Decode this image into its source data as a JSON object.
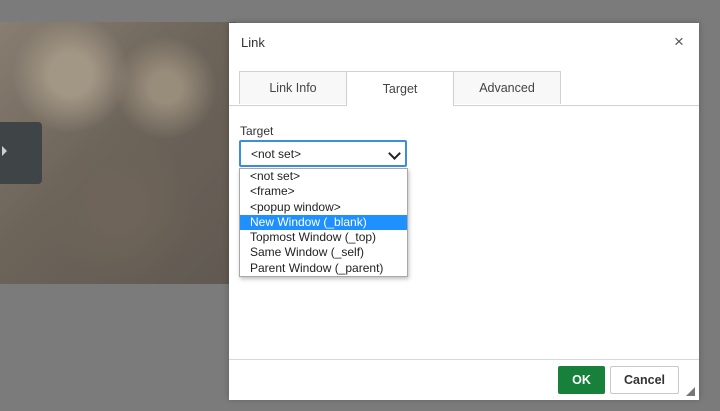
{
  "dialog": {
    "title": "Link",
    "close_label": "×",
    "tabs": [
      {
        "label": "Link Info",
        "active": false
      },
      {
        "label": "Target",
        "active": true
      },
      {
        "label": "Advanced",
        "active": false
      }
    ],
    "target": {
      "label": "Target",
      "selected_value": "<not set>",
      "options": [
        "<not set>",
        "<frame>",
        "<popup window>",
        "New Window (_blank)",
        "Topmost Window (_top)",
        "Same Window (_self)",
        "Parent Window (_parent)"
      ],
      "highlighted_option": "New Window (_blank)"
    },
    "footer": {
      "ok_label": "OK",
      "cancel_label": "Cancel"
    }
  },
  "colors": {
    "ok_button": "#17803a",
    "focus_border": "#3c8ddb",
    "highlight": "#1e90ff",
    "overlay": "#7b7b7b"
  }
}
